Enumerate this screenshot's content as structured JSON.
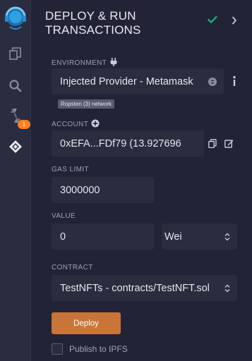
{
  "icon_bar": {
    "logo_name": "remix-logo",
    "items": [
      {
        "name": "file-explorer-icon"
      },
      {
        "name": "search-icon"
      },
      {
        "name": "solidity-compiler-icon",
        "badge": "1"
      },
      {
        "name": "deploy-run-icon"
      }
    ]
  },
  "panel": {
    "title": "DEPLOY & RUN TRANSACTIONS",
    "environment": {
      "label": "ENVIRONMENT",
      "value": "Injected Provider - Metamask",
      "network": "Ropsten (3) network"
    },
    "account": {
      "label": "ACCOUNT",
      "value": "0xEFA...FDf79 (13.927696"
    },
    "gas_limit": {
      "label": "GAS LIMIT",
      "value": "3000000"
    },
    "value": {
      "label": "VALUE",
      "amount": "0",
      "unit": "Wei"
    },
    "contract": {
      "label": "CONTRACT",
      "value": "TestNFTs - contracts/TestNFT.sol"
    },
    "deploy_label": "Deploy",
    "publish_label": "Publish to IPFS"
  },
  "colors": {
    "accent": "#c97539",
    "check": "#1ea97c",
    "badge": "#ff7f1f"
  }
}
